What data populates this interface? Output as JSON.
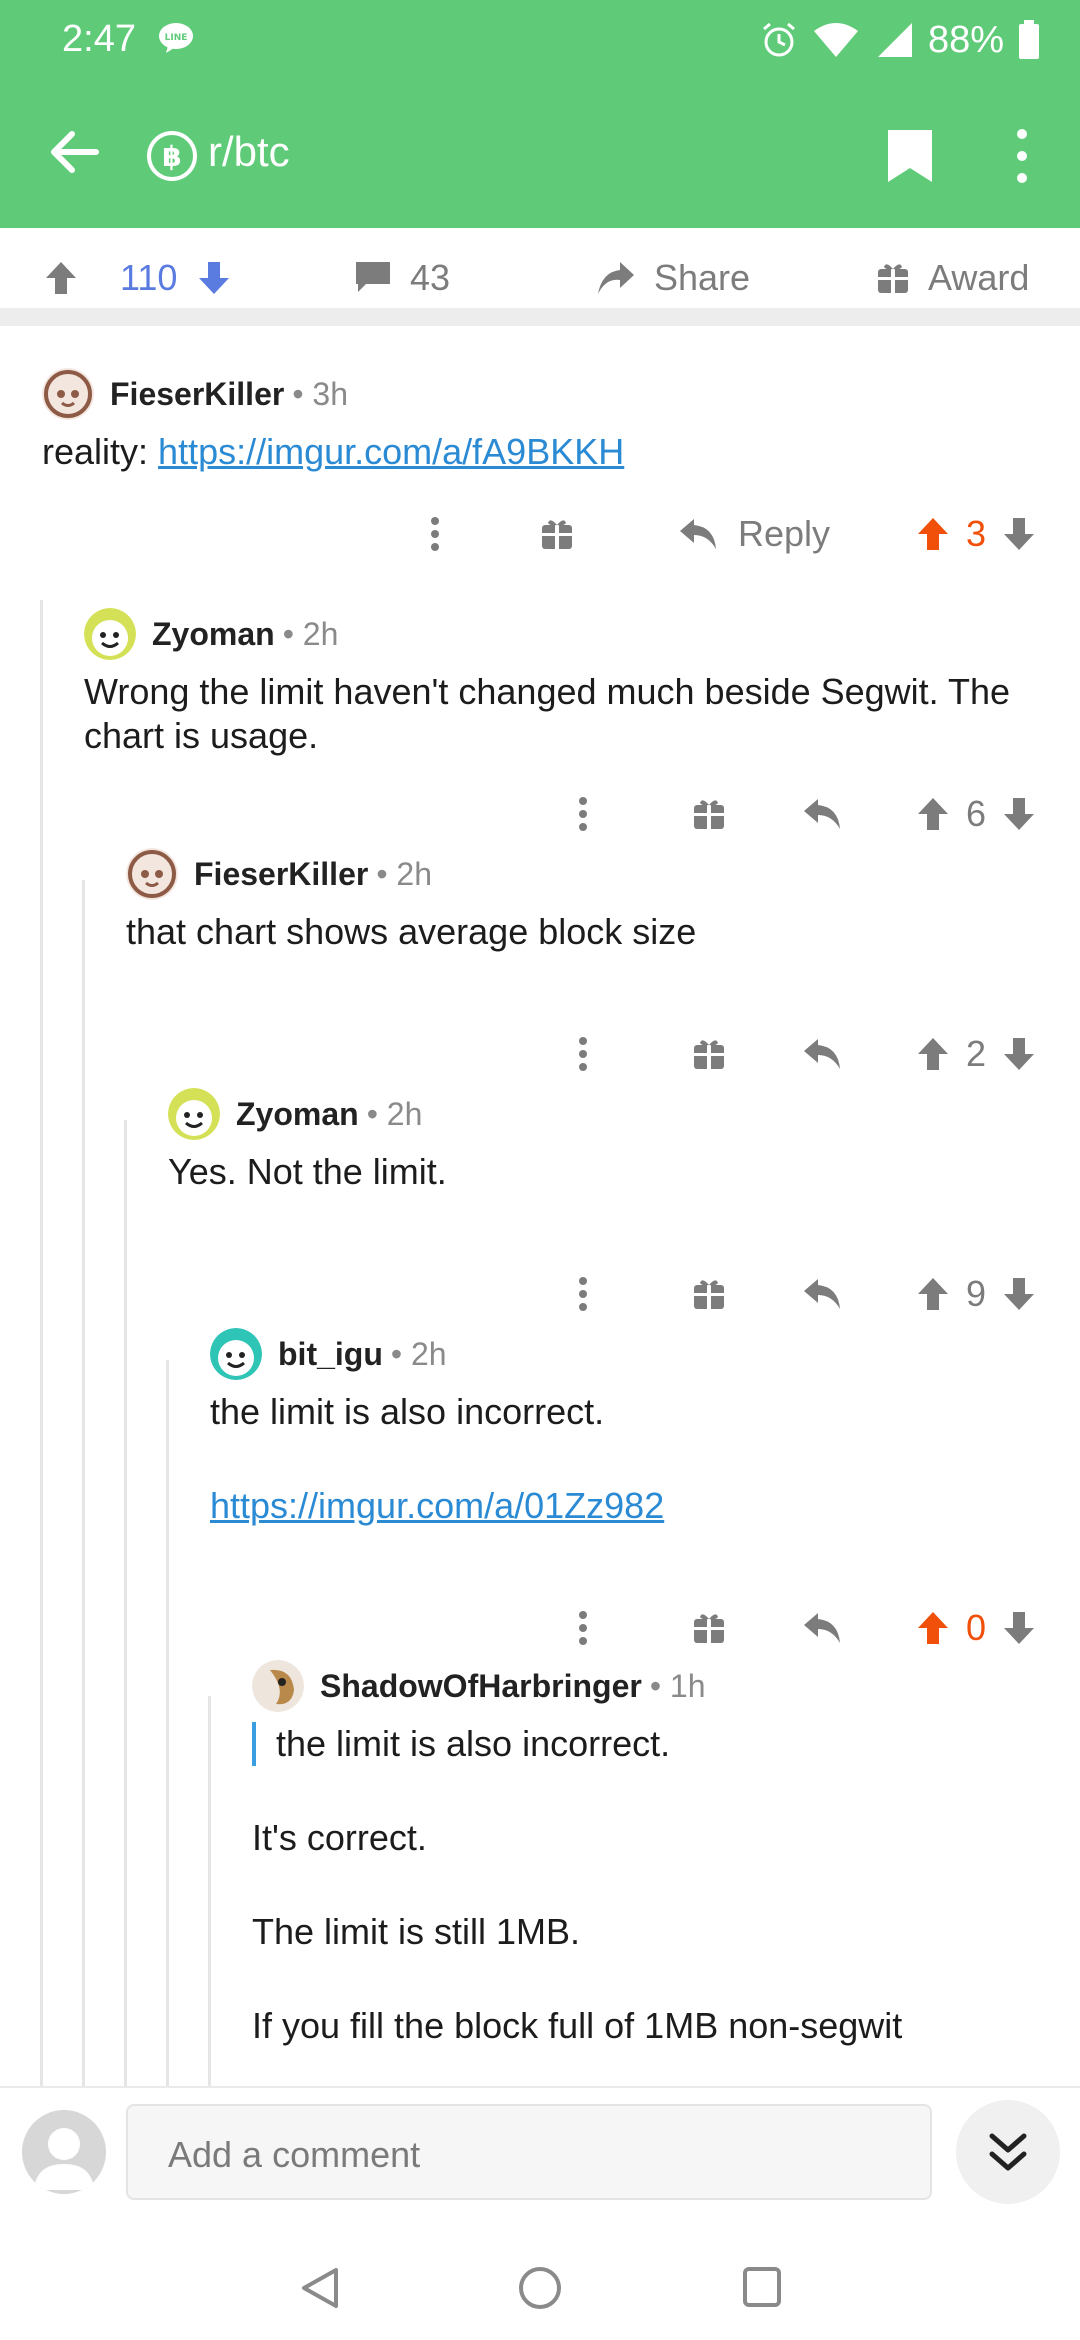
{
  "status_bar": {
    "time": "2:47",
    "battery": "88%"
  },
  "app_bar": {
    "subreddit": "r/btc"
  },
  "post_bar": {
    "score": "110",
    "comments": "43",
    "share": "Share",
    "award": "Award"
  },
  "comments": [
    {
      "author": "FieserKiller",
      "time": "3h",
      "text_prefix": "reality: ",
      "link": "https://imgur.com/a/fA9BKKH",
      "reply": "Reply",
      "score": "3",
      "upvoted": true
    },
    {
      "author": "Zyoman",
      "time": "2h",
      "text": "Wrong the limit haven't changed much beside Segwit. The chart is usage.",
      "score": "6"
    },
    {
      "author": "FieserKiller",
      "time": "2h",
      "text": "that chart shows average block size",
      "score": "2"
    },
    {
      "author": "Zyoman",
      "time": "2h",
      "text": "Yes. Not the limit.",
      "score": "9"
    },
    {
      "author": "bit_igu",
      "time": "2h",
      "text": "the limit is also incorrect.",
      "link": "https://imgur.com/a/01Zz982",
      "score": "0",
      "upvoted": true
    },
    {
      "author": "ShadowOfHarbringer",
      "time": "1h",
      "quote": "the limit is also incorrect.",
      "p1": "It's correct.",
      "p2": "The limit is still 1MB.",
      "p3": "If you fill the block full of 1MB non-segwit"
    }
  ],
  "composer": {
    "placeholder": "Add a comment"
  },
  "colors": {
    "accent": "#5fcb79",
    "upvote": "#f0500a",
    "score_blue": "#5a7be0",
    "link": "#2a8ad4"
  }
}
